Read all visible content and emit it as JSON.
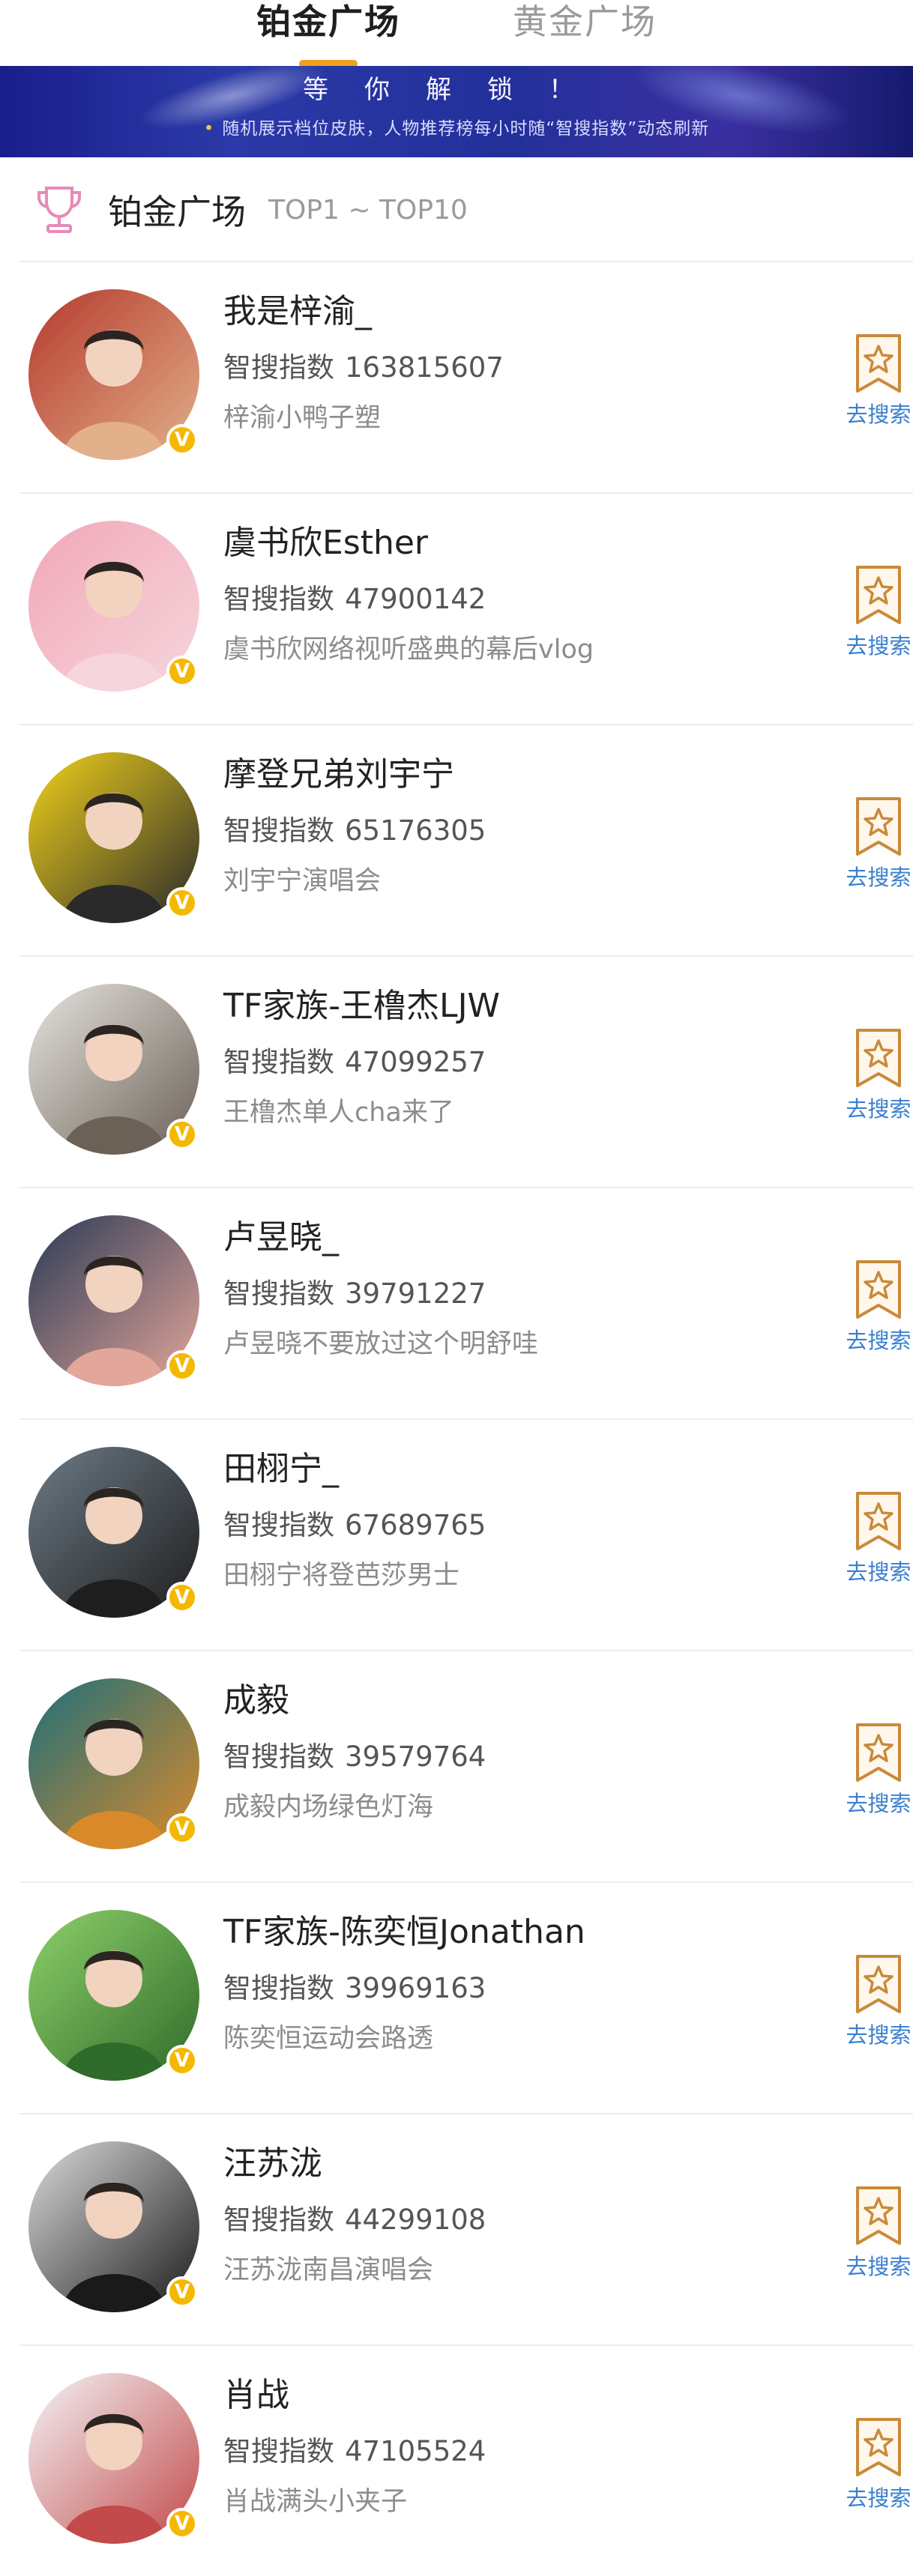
{
  "tabs": [
    {
      "label": "铂金广场",
      "active": true
    },
    {
      "label": "黄金广场",
      "active": false
    }
  ],
  "banner": {
    "title": "等你解锁！",
    "subtitle": "随机展示档位皮肤，人物推荐榜每小时随“智搜指数”动态刷新"
  },
  "section": {
    "title": "铂金广场",
    "range": "TOP1 ~ TOP10"
  },
  "score_label": "智搜指数",
  "search_label": "去搜索",
  "items": [
    {
      "name": "我是梓渝_",
      "score": "163815607",
      "desc": "梓渝小鸭子塑",
      "avatar_bg": "#b53a2e",
      "avatar_bg2": "#e2b08a"
    },
    {
      "name": "虞书欣Esther",
      "score": "47900142",
      "desc": "虞书欣网络视听盛典的幕后vlog",
      "avatar_bg": "#f2a7b8",
      "avatar_bg2": "#f6d6dc"
    },
    {
      "name": "摩登兄弟刘宇宁",
      "score": "65176305",
      "desc": "刘宇宁演唱会",
      "avatar_bg": "#f2d21a",
      "avatar_bg2": "#2a2a2a"
    },
    {
      "name": "TF家族-王橹杰LJW",
      "score": "47099257",
      "desc": "王橹杰单人cha来了",
      "avatar_bg": "#e6e3de",
      "avatar_bg2": "#6b6157"
    },
    {
      "name": "卢昱晓_",
      "score": "39791227",
      "desc": "卢昱晓不要放过这个明舒哇",
      "avatar_bg": "#2a3a55",
      "avatar_bg2": "#e3a69a"
    },
    {
      "name": "田栩宁_",
      "score": "67689765",
      "desc": "田栩宁将登芭莎男士",
      "avatar_bg": "#6c7a86",
      "avatar_bg2": "#1e1e1e"
    },
    {
      "name": "成毅",
      "score": "39579764",
      "desc": "成毅内场绿色灯海",
      "avatar_bg": "#1f6f7a",
      "avatar_bg2": "#d88a2a"
    },
    {
      "name": "TF家族-陈奕恒Jonathan",
      "score": "39969163",
      "desc": "陈奕恒运动会路透",
      "avatar_bg": "#8ed06a",
      "avatar_bg2": "#2f6b2a"
    },
    {
      "name": "汪苏泷",
      "score": "44299108",
      "desc": "汪苏泷南昌演唱会",
      "avatar_bg": "#dcdcdc",
      "avatar_bg2": "#1a1a1a"
    },
    {
      "name": "肖战",
      "score": "47105524",
      "desc": "肖战满头小夹子",
      "avatar_bg": "#f4f4f6",
      "avatar_bg2": "#c24a4a"
    }
  ],
  "colors": {
    "accent": "#f0a020",
    "link": "#3a7fd0",
    "verify": "#f5b800",
    "banner": "#22309a"
  }
}
